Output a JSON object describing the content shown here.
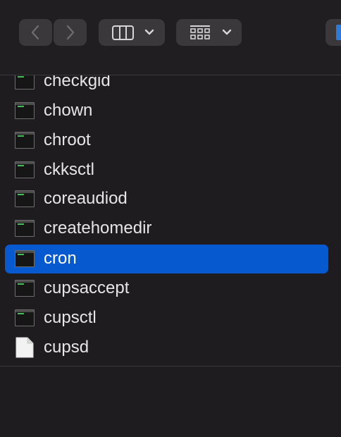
{
  "toolbar": {
    "back_icon": "chevron-left-icon",
    "forward_icon": "chevron-right-icon",
    "view_icon": "columns-view-icon",
    "group_icon": "grid-group-icon"
  },
  "files": [
    {
      "name": "checkgid",
      "type": "exec"
    },
    {
      "name": "chown",
      "type": "exec"
    },
    {
      "name": "chroot",
      "type": "exec"
    },
    {
      "name": "ckksctl",
      "type": "exec"
    },
    {
      "name": "coreaudiod",
      "type": "exec"
    },
    {
      "name": "createhomedir",
      "type": "exec"
    },
    {
      "name": "cron",
      "type": "exec",
      "selected": true
    },
    {
      "name": "cupsaccept",
      "type": "exec"
    },
    {
      "name": "cupsctl",
      "type": "exec"
    },
    {
      "name": "cupsd",
      "type": "document"
    }
  ],
  "colors": {
    "selection": "#0759d0",
    "background": "#1e1c1e",
    "terminal_text": "#3fc15a"
  }
}
